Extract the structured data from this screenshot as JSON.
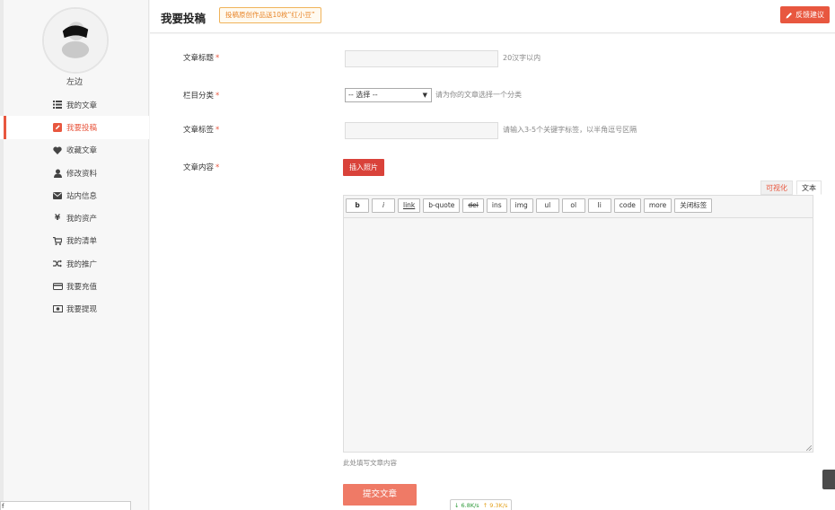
{
  "sidebar": {
    "username": "左边",
    "items": [
      {
        "label": "我的文章",
        "icon": "list-icon"
      },
      {
        "label": "我要投稿",
        "icon": "edit-icon"
      },
      {
        "label": "收藏文章",
        "icon": "heart-icon"
      },
      {
        "label": "修改资料",
        "icon": "user-icon"
      },
      {
        "label": "站内信息",
        "icon": "envelope-icon"
      },
      {
        "label": "我的资产",
        "icon": "yuan-icon"
      },
      {
        "label": "我的清单",
        "icon": "cart-icon"
      },
      {
        "label": "我的推广",
        "icon": "shuffle-icon"
      },
      {
        "label": "我要充值",
        "icon": "credit-card-icon"
      },
      {
        "label": "我要提现",
        "icon": "cash-icon"
      }
    ],
    "active_index": 1,
    "bottom_input_value": "f"
  },
  "header": {
    "title": "我要投稿",
    "promo": "投稿原创作品送10枚“红小豆”",
    "feedback_label": "反馈建议"
  },
  "form": {
    "title_label": "文章标题",
    "title_hint": "20汉字以内",
    "category_label": "栏目分类",
    "category_selected": "-- 选择 --",
    "category_hint": "请为你的文章选择一个分类",
    "tags_label": "文章标签",
    "tags_hint": "请输入3-5个关键字标签，以半角逗号区隔",
    "content_label": "文章内容",
    "insert_photo_label": "插入照片",
    "required_mark": "*",
    "editor_tabs": [
      "可视化",
      "文本"
    ],
    "toolbar": [
      "b",
      "i",
      "link",
      "b-quote",
      "del",
      "ins",
      "img",
      "ul",
      "ol",
      "li",
      "code",
      "more",
      "关闭标签"
    ],
    "editor_hint": "此处填写文章内容",
    "submit_label": "提交文章"
  },
  "net_speed": {
    "down": "6.8K/s",
    "up": "9.3K/s"
  },
  "colors": {
    "accent": "#e8573f",
    "submit": "#ef7a66",
    "promo_border": "#f0b35a"
  }
}
